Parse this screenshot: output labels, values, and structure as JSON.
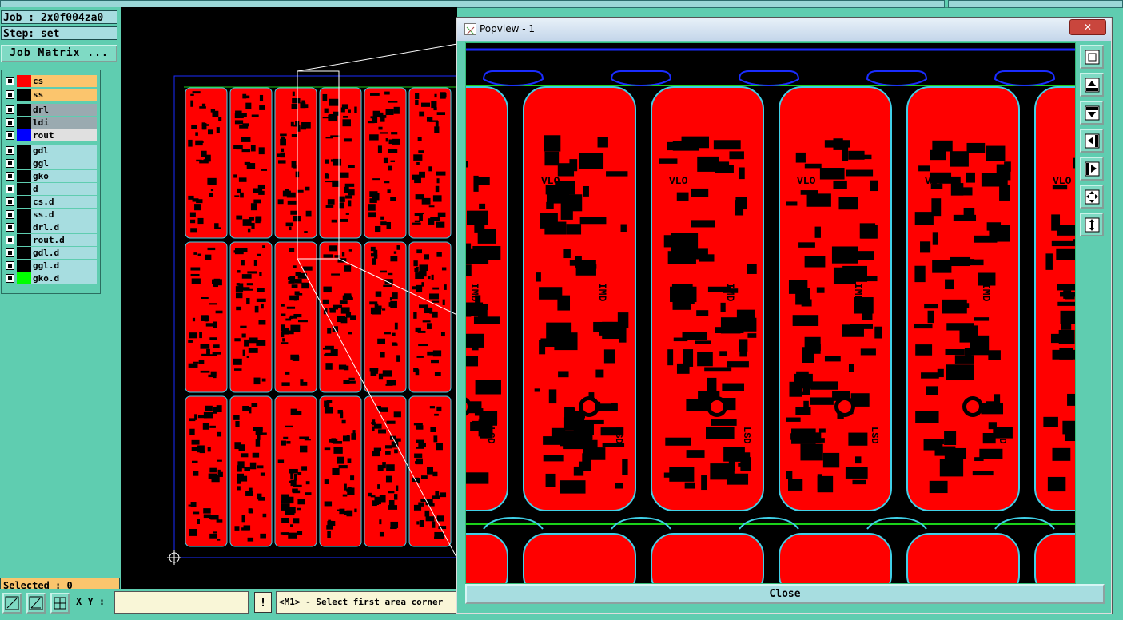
{
  "header": {
    "job_label": "Job : 2x0f004za0",
    "step_label": "Step: set",
    "job_matrix_button": "Job Matrix ..."
  },
  "layers": [
    {
      "name": "cs",
      "color": "#ff0000",
      "bg": "#fbc56d"
    },
    {
      "name": "ss",
      "color": "#000000",
      "bg": "#fbc56d"
    },
    {
      "name": "drl",
      "color": "#000000",
      "bg": "#9aaab0"
    },
    {
      "name": "ldi",
      "color": "#000000",
      "bg": "#9aaab0"
    },
    {
      "name": "rout",
      "color": "#0000ff",
      "bg": "#e0e0e0"
    },
    {
      "name": "gdl",
      "color": "#000000",
      "bg": "#a7dde0"
    },
    {
      "name": "ggl",
      "color": "#000000",
      "bg": "#a7dde0"
    },
    {
      "name": "gko",
      "color": "#000000",
      "bg": "#a7dde0"
    },
    {
      "name": "d",
      "color": "#000000",
      "bg": "#a7dde0"
    },
    {
      "name": "cs.d",
      "color": "#000000",
      "bg": "#a7dde0"
    },
    {
      "name": "ss.d",
      "color": "#000000",
      "bg": "#a7dde0"
    },
    {
      "name": "drl.d",
      "color": "#000000",
      "bg": "#a7dde0"
    },
    {
      "name": "rout.d",
      "color": "#000000",
      "bg": "#a7dde0"
    },
    {
      "name": "gdl.d",
      "color": "#000000",
      "bg": "#a7dde0"
    },
    {
      "name": "ggl.d",
      "color": "#000000",
      "bg": "#a7dde0"
    },
    {
      "name": "gko.d",
      "color": "#00ff00",
      "bg": "#a7dde0"
    }
  ],
  "status": {
    "selected": "Selected : 0",
    "xy_label": "X Y :",
    "xy_value": "",
    "warning_glyph": "!",
    "prompt": "<M1> - Select first area corner"
  },
  "popview": {
    "title": "Popview - 1",
    "close_x": "✕",
    "close_button": "Close",
    "board_labels": {
      "top": "VLO",
      "mid": "IMD",
      "bottom": "LSD"
    },
    "sidebar_icons": [
      "zoom-window-icon",
      "pan-up-icon",
      "pan-down-icon",
      "pan-left-icon",
      "pan-right-icon",
      "zoom-fit-icon",
      "zoom-in-icon"
    ]
  },
  "colors": {
    "copper": "#ff0000",
    "outline": "#40d0e8",
    "rout": "#1a2cff",
    "gko": "#1ad11a",
    "panel": "#5fcdb0"
  }
}
